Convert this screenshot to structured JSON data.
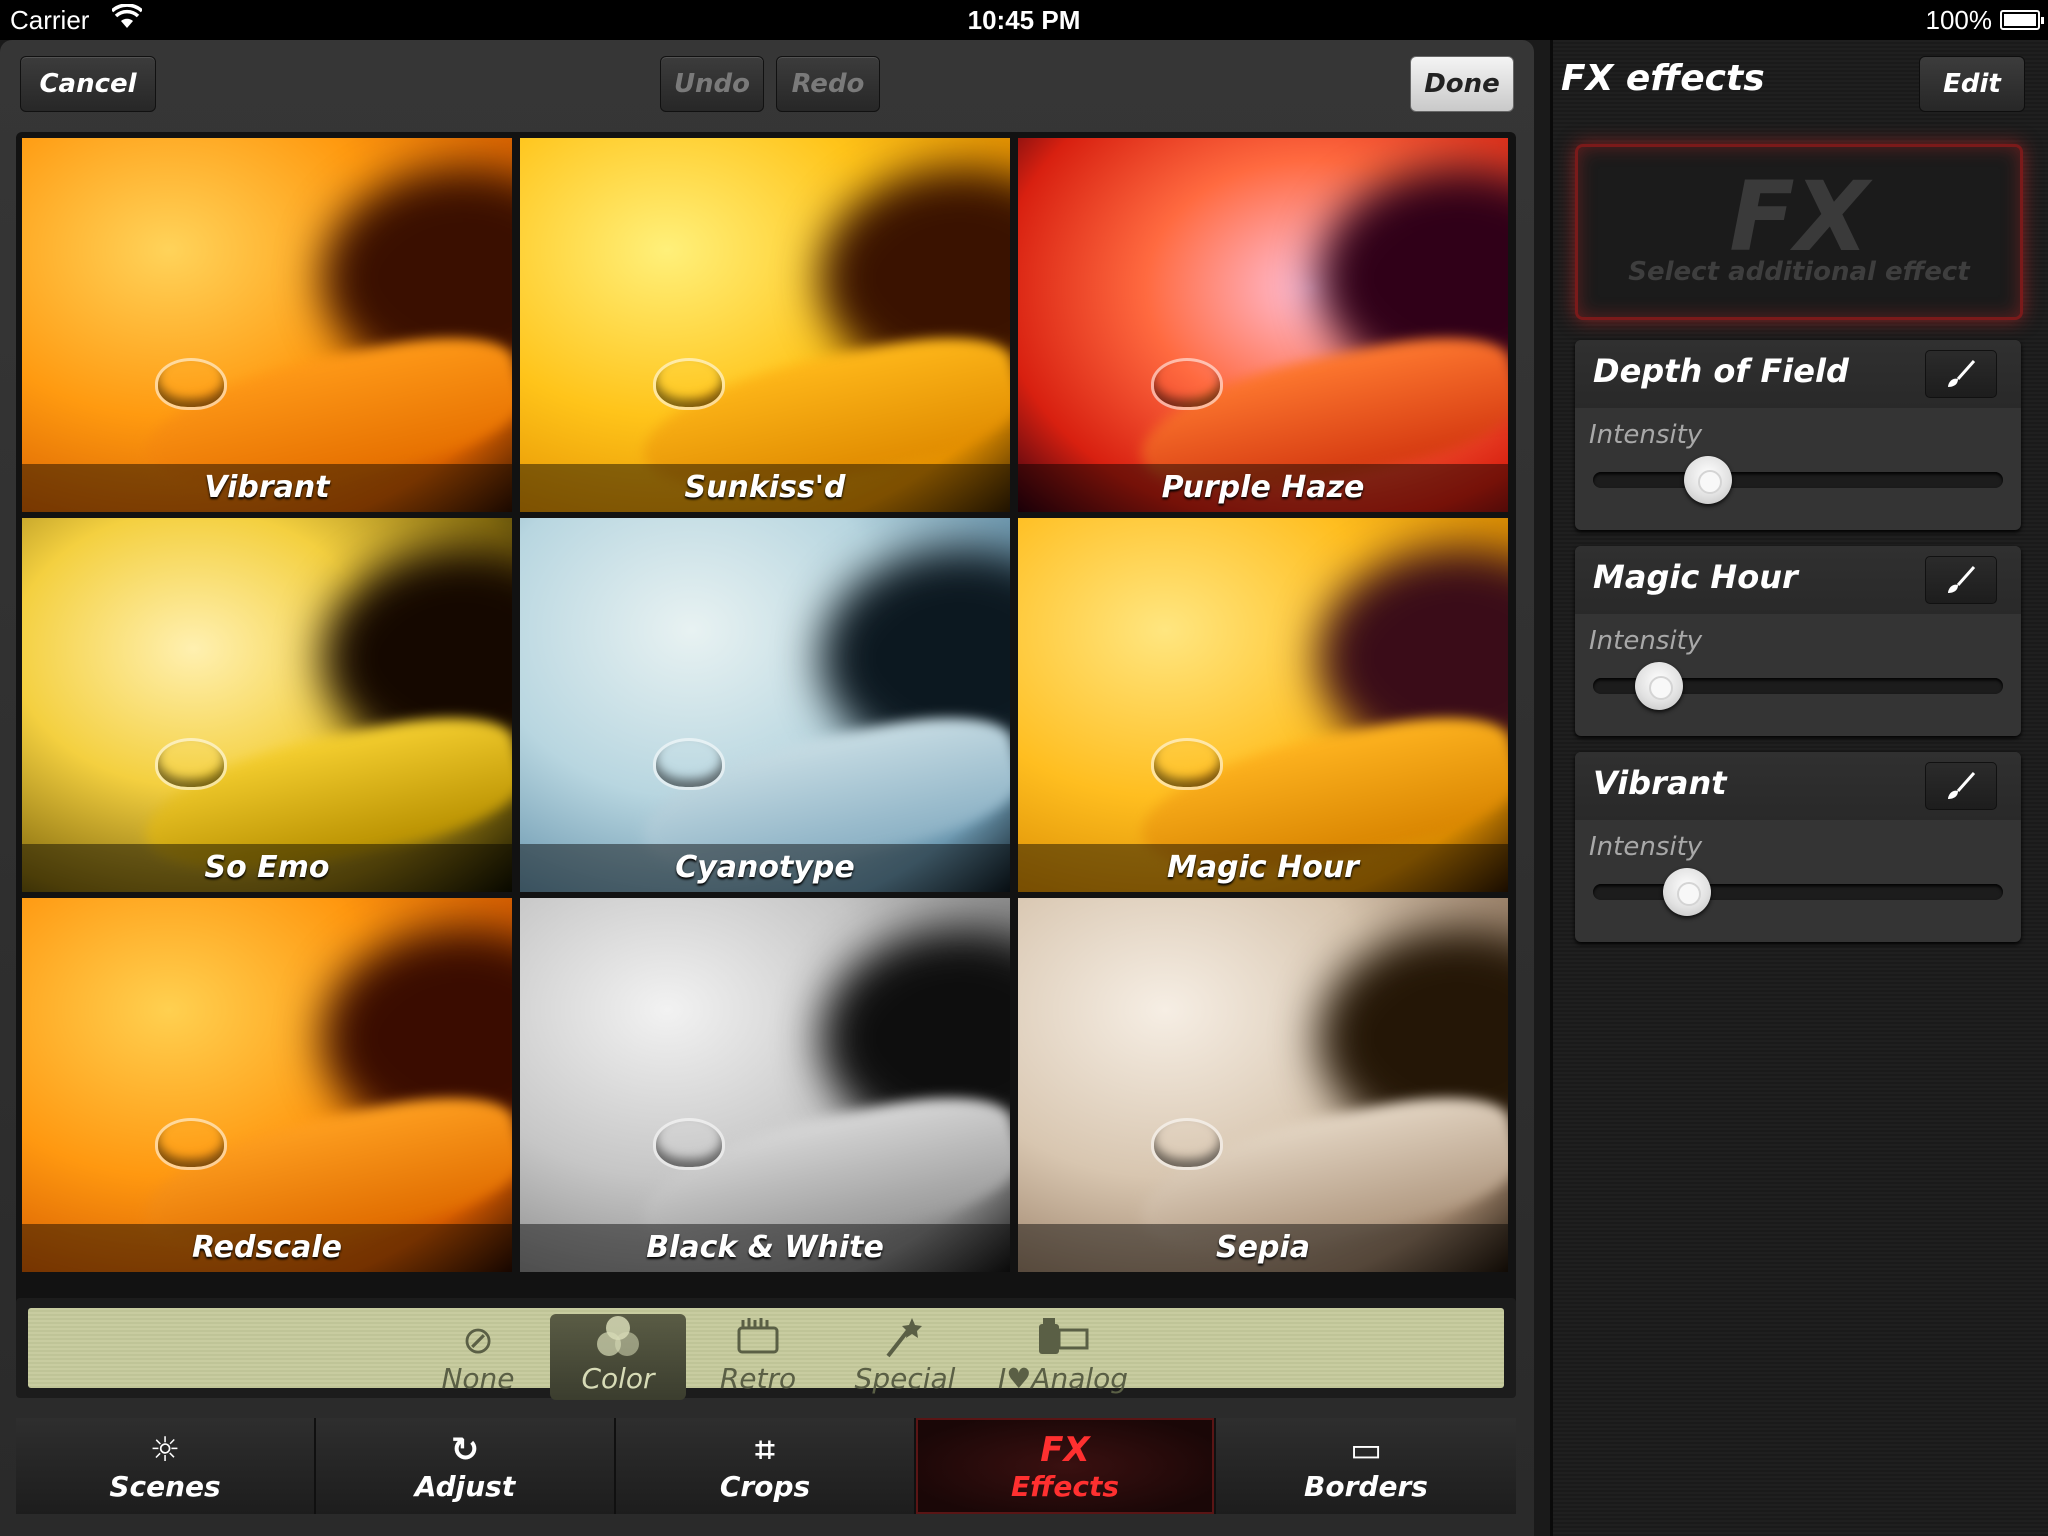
{
  "status": {
    "carrier": "Carrier",
    "time": "10:45 PM",
    "battery": "100%"
  },
  "toolbar": {
    "cancel": "Cancel",
    "undo": "Undo",
    "redo": "Redo",
    "done": "Done"
  },
  "presets": [
    {
      "label": "Vibrant"
    },
    {
      "label": "Sunkiss'd"
    },
    {
      "label": "Purple Haze"
    },
    {
      "label": "So Emo"
    },
    {
      "label": "Cyanotype"
    },
    {
      "label": "Magic Hour"
    },
    {
      "label": "Redscale"
    },
    {
      "label": "Black & White"
    },
    {
      "label": "Sepia"
    }
  ],
  "categories": [
    {
      "label": "None",
      "icon": "none-icon"
    },
    {
      "label": "Color",
      "icon": "color-circles-icon",
      "selected": true
    },
    {
      "label": "Retro",
      "icon": "retro-camera-icon"
    },
    {
      "label": "Special",
      "icon": "magic-wand-icon"
    },
    {
      "label": "I♥Analog",
      "icon": "film-canister-icon"
    }
  ],
  "tabs": [
    {
      "label": "Scenes",
      "icon": "scenes-icon"
    },
    {
      "label": "Adjust",
      "icon": "adjust-icon"
    },
    {
      "label": "Crops",
      "icon": "crop-icon"
    },
    {
      "label": "Effects",
      "icon": "fx-icon",
      "icon_text": "FX",
      "selected": true
    },
    {
      "label": "Borders",
      "icon": "borders-icon"
    }
  ],
  "side": {
    "title": "FX effects",
    "edit": "Edit",
    "slot_big": "FX",
    "slot_hint": "Select additional effect"
  },
  "effects": [
    {
      "name": "Depth of Field",
      "label": "Intensity",
      "intensity": 0.28
    },
    {
      "name": "Magic Hour",
      "label": "Intensity",
      "intensity": 0.16
    },
    {
      "name": "Vibrant",
      "label": "Intensity",
      "intensity": 0.23
    }
  ],
  "colors": {
    "accent_red": "#ff3030",
    "lcd": "#c8cca0"
  }
}
